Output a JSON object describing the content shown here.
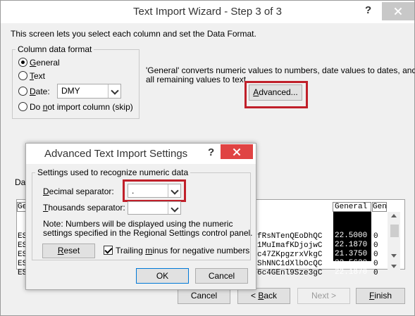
{
  "wizard": {
    "title": "Text Import Wizard - Step 3 of 3",
    "help_label": "?",
    "intro": "This screen lets you select each column and set the Data Format.",
    "column_format": {
      "legend": "Column data format",
      "options": [
        {
          "pre": "",
          "mnemonic": "G",
          "post": "eneral",
          "selected": true
        },
        {
          "pre": "",
          "mnemonic": "T",
          "post": "ext",
          "selected": false
        },
        {
          "pre": "",
          "mnemonic": "D",
          "post": "ate:",
          "selected": false
        },
        {
          "pre": "Do ",
          "mnemonic": "n",
          "post": "ot import column (skip)",
          "selected": false
        }
      ],
      "date_format_value": "DMY"
    },
    "general_note_line1": "'General' converts numeric values to numbers, date values to dates, and",
    "general_note_line2": "all remaining values to text.",
    "advanced_button": {
      "pre": "",
      "mnemonic": "A",
      "post": "dvanced..."
    },
    "preview_label_fragment": "Da",
    "preview": {
      "col_header_left": "Gen",
      "row_prefix": [
        "ES",
        "ES",
        "ES",
        "ES",
        "ES"
      ],
      "text_cells": [
        "fRsNTenQEoDhQC",
        "1MuImafKDjojwC",
        "c47ZKpgzrxVkgC",
        "ShNNC1dXlbOcQC",
        "6c4GEnl9Sze3gC"
      ],
      "general_header": "General",
      "general_values": [
        "22.5000",
        "22.1870",
        "21.3750",
        "22.5620",
        "22.1870"
      ],
      "next_header": "Gen",
      "next_values": [
        "0",
        "0",
        "0",
        "0",
        "0"
      ]
    },
    "buttons": {
      "cancel": "Cancel",
      "back_pre": "< ",
      "back_mnemonic": "B",
      "back_post": "ack",
      "next": "Next >",
      "finish_mnemonic": "F",
      "finish_post": "inish"
    }
  },
  "advanced_dialog": {
    "title": "Advanced Text Import Settings",
    "help_label": "?",
    "section_label": "Settings used to recognize numeric data",
    "decimal_label": {
      "pre": "",
      "mnemonic": "D",
      "post": "ecimal separator:"
    },
    "decimal_value": ".",
    "thousands_label": {
      "pre": "",
      "mnemonic": "T",
      "post": "housands separator:"
    },
    "thousands_value": "",
    "note_line1": "Note: Numbers will be displayed using the numeric",
    "note_line2": "settings specified in the Regional Settings control panel.",
    "reset_button": {
      "pre": "",
      "mnemonic": "R",
      "post": "eset"
    },
    "trailing_minus": {
      "pre": "Trailing ",
      "mnemonic": "m",
      "post": "inus for negative numbers",
      "checked": true
    },
    "ok_label": "OK",
    "cancel_label": "Cancel"
  },
  "colors": {
    "highlight": "#c0202a",
    "close_hover": "#e04343",
    "window_bg": "#f0f0f0"
  }
}
